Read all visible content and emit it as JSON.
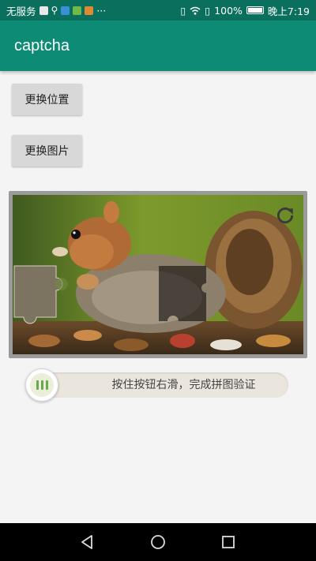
{
  "status_bar": {
    "carrier": "无服务",
    "percent": "100%",
    "time": "晚上7:19",
    "more_dots": "···"
  },
  "app": {
    "title": "captcha"
  },
  "buttons": {
    "change_position": "更换位置",
    "change_image": "更换图片"
  },
  "slider": {
    "hint": "按住按钮右滑，完成拼图验证",
    "progress": 0
  },
  "colors": {
    "status_bar": "#0b6f5d",
    "app_bar": "#0e8b74",
    "background": "#f4f4f4",
    "button": "#d8d8d8",
    "slider_track": "#ebe6dd",
    "handle_accent": "#6aa84f"
  },
  "icons": {
    "refresh": "refresh-icon",
    "slider_grip": "grip-icon",
    "back": "back-icon",
    "home": "home-icon",
    "recents": "recents-icon"
  }
}
